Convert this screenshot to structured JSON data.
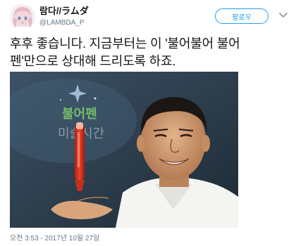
{
  "user": {
    "display_name": "람다//ラムダ",
    "handle": "@LAMBDA_P",
    "avatar_icon": "anime-avatar"
  },
  "follow_button": {
    "label": "팔로우"
  },
  "menu_icon": "chevron-down-icon",
  "tweet": {
    "text_line1": "후후 좋습니다. 지금부터는 이 '불어불어 불어",
    "text_line2": "펜'만으로 상대해 드리도록 하죠."
  },
  "media": {
    "chalkboard_text_line1": "불어펜",
    "chalkboard_text_line2": "미술시간"
  },
  "timestamp": "오전 3:53 - 2017년 10월 27일",
  "colors": {
    "accent": "#1da1f2",
    "text": "#14171a",
    "secondary_text": "#657786"
  }
}
